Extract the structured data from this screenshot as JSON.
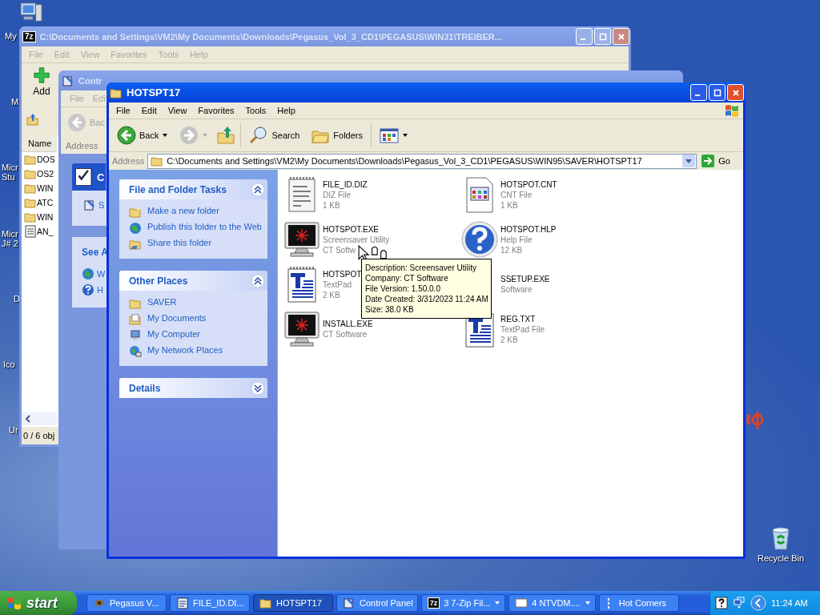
{
  "desktop": {
    "icons": [
      {
        "lines": [
          "My"
        ]
      },
      {
        "lines": [
          "M"
        ]
      },
      {
        "lines": [
          "Micr",
          "Stu"
        ]
      },
      {
        "lines": [
          "Micr",
          "J# 2"
        ]
      },
      {
        "lines": [
          "D"
        ]
      },
      {
        "lines": [
          "Ico"
        ]
      },
      {
        "lines": [
          "Ur"
        ]
      }
    ],
    "recycle_bin": {
      "label": "Recycle Bin"
    }
  },
  "zip_window": {
    "badge": "7z",
    "title": "C:\\Documents and Settings\\VM2\\My Documents\\Downloads\\Pegasus_Vol_3_CD1\\PEGASUS\\WIN31\\TREIBER...",
    "active": false,
    "menu": [
      "File",
      "Edit",
      "View",
      "Favorites",
      "Tools",
      "Help"
    ],
    "add_button": "Add",
    "column": "Name",
    "rows": [
      {
        "name": "DOS",
        "kind": "folder"
      },
      {
        "name": "OS2",
        "kind": "folder"
      },
      {
        "name": "WIN",
        "kind": "folder"
      },
      {
        "name": "ATC",
        "kind": "folder"
      },
      {
        "name": "WIN",
        "kind": "folder"
      },
      {
        "name": "AN_",
        "kind": "document"
      }
    ],
    "status": "0 / 6 obj"
  },
  "control_panel_window": {
    "title": "Contr",
    "active": false,
    "menu": [
      "File",
      "Edi"
    ],
    "back_button": "Bac",
    "address_label": "Address",
    "panel_title": "C",
    "panel_items": [
      "S"
    ],
    "see_also_title": "See A",
    "see_also_items": [
      {
        "label": "W",
        "kind": "globe"
      },
      {
        "label": "H",
        "kind": "help"
      }
    ]
  },
  "explorer_window": {
    "title": "HOTSPT17",
    "active": true,
    "menu": [
      "File",
      "Edit",
      "View",
      "Favorites",
      "Tools",
      "Help"
    ],
    "toolbar": {
      "back": "Back",
      "search": "Search",
      "folders": "Folders"
    },
    "address_label": "Address",
    "address": "C:\\Documents and Settings\\VM2\\My Documents\\Downloads\\Pegasus_Vol_3_CD1\\PEGASUS\\WIN95\\SAVER\\HOTSPT17",
    "go": "Go",
    "panels": [
      {
        "title": "File and Folder Tasks",
        "expanded": true,
        "items": [
          {
            "label": "Make a new folder",
            "kind": "new-folder"
          },
          {
            "label": "Publish this folder to the Web",
            "kind": "globe"
          },
          {
            "label": "Share this folder",
            "kind": "share-folder"
          }
        ]
      },
      {
        "title": "Other Places",
        "expanded": true,
        "items": [
          {
            "label": "SAVER",
            "kind": "folder"
          },
          {
            "label": "My Documents",
            "kind": "documents"
          },
          {
            "label": "My Computer",
            "kind": "computer"
          },
          {
            "label": "My Network Places",
            "kind": "network"
          }
        ]
      },
      {
        "title": "Details",
        "expanded": false
      }
    ],
    "files": [
      {
        "name": "FILE_ID.DIZ",
        "lines": [
          "DIZ File",
          "1 KB"
        ],
        "kind": "notepad"
      },
      {
        "name": "HOTSPOT.CNT",
        "lines": [
          "CNT File",
          "1 KB"
        ],
        "kind": "cnt"
      },
      {
        "name": "HOTSPOT.EXE",
        "lines": [
          "Screensaver Utility",
          "CT Softw"
        ],
        "kind": "screensaver"
      },
      {
        "name": "HOTSPOT.HLP",
        "lines": [
          "Help File",
          "12 KB"
        ],
        "kind": "help"
      },
      {
        "name": "HOTSPOT",
        "lines": [
          "TextPad",
          "2 KB"
        ],
        "kind": "textpad"
      },
      {
        "name": "SSETUP.EXE",
        "lines": [
          "Software"
        ],
        "kind": "hidden"
      },
      {
        "name": "INSTALL.EXE",
        "lines": [
          "CT Software"
        ],
        "kind": "screensaver"
      },
      {
        "name": "REG.TXT",
        "lines": [
          "TextPad File",
          "2 KB"
        ],
        "kind": "textpad"
      }
    ]
  },
  "tooltip": {
    "lines": [
      "Description: Screensaver Utility",
      "Company: CT Software",
      "File Version: 1.50.0.0",
      "Date Created: 3/31/2023 11:24 AM",
      "Size: 38.0 KB"
    ]
  },
  "taskbar": {
    "start": "start",
    "items": [
      {
        "label": "Pegasus V...",
        "kind": "app",
        "selected": false,
        "grouped": false
      },
      {
        "label": "FILE_ID.DI...",
        "kind": "notepad",
        "selected": false,
        "grouped": false
      },
      {
        "label": "HOTSPT17",
        "kind": "folder",
        "selected": true,
        "grouped": false
      },
      {
        "label": "Control Panel",
        "kind": "control",
        "selected": false,
        "grouped": false
      },
      {
        "badge": "7z",
        "label": "3 7-Zip Fil...",
        "kind": "badge",
        "selected": false,
        "grouped": true
      },
      {
        "label": "4 NTVDM....",
        "kind": "window",
        "selected": false,
        "grouped": true
      },
      {
        "label": "Hot Corners",
        "kind": "dots",
        "selected": false,
        "grouped": false
      }
    ],
    "clock": "11:24 AM"
  }
}
